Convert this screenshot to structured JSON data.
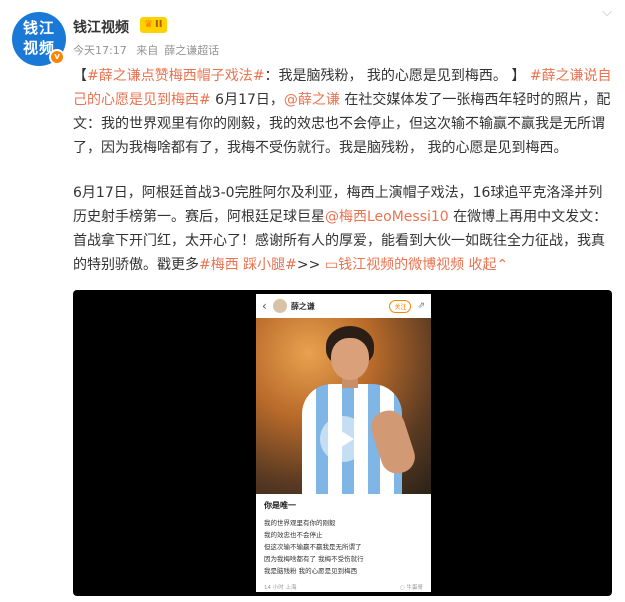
{
  "author": {
    "avatar_text": "钱江视频",
    "name": "钱江视频",
    "level_badge": "II",
    "verified_mark": "v"
  },
  "meta": {
    "time": "今天17:17",
    "source_prefix": "来自",
    "source": "薛之谦超话"
  },
  "post": {
    "p1": {
      "bracket_open": "【",
      "tag1": "#薛之谦点赞梅西帽子戏法#",
      "t1": "：我是脑残粉， 我的心愿是见到梅西。 】",
      "tag2": "#薛之谦说自己的心愿是见到梅西#",
      "t2": " 6月17日，",
      "mention": "@薛之谦",
      "t3": " 在社交媒体发了一张梅西年轻时的照片，配文：我的世界观里有你的刚毅，我的效忠也不会停止，但这次输不输赢不赢我是无所谓了，因为我梅啥都有了，我梅不受伤就行。我是脑残粉， 我的心愿是见到梅西。"
    },
    "p2": {
      "t1": "6月17日，阿根廷首战3-0完胜阿尔及利亚，梅西上演帽子戏法，16球追平克洛泽并列历史射手榜第一。赛后，阿根廷足球巨星",
      "mention": "@梅西LeoMessi10",
      "t2": " 在微博上再用中文发文：首战拿下开门红，太开心了！感谢所有人的厚爱，能看到大伙一如既往全力征战，我真的特别骄傲。戳更多",
      "tags": "#梅西 踩小腿#",
      "arrows": ">>",
      "video_icon": "▭",
      "video_link": "钱江视频的微博视频",
      "collapse": "收起",
      "collapse_icon": "⌃"
    }
  },
  "video": {
    "phone_user": "薛之谦",
    "phone_follow": "关注",
    "phone_title": "你是唯一",
    "phone_lines": [
      "我的世界观里有你的刚毅",
      "我的效忠也不会停止",
      "但这次输不输赢不赢我是无所谓了",
      "因为我梅啥都有了 我梅不受伤就行",
      "我是脑残粉 我的心愿是见到梅西"
    ],
    "phone_foot_left": "14 小时 上海",
    "phone_foot_right": "○ 牛蛋哥"
  },
  "colors": {
    "accent": "#eb7350",
    "avatar_bg": "#1a78d6",
    "badge": "#ffd100",
    "video_bg": "#000000"
  }
}
